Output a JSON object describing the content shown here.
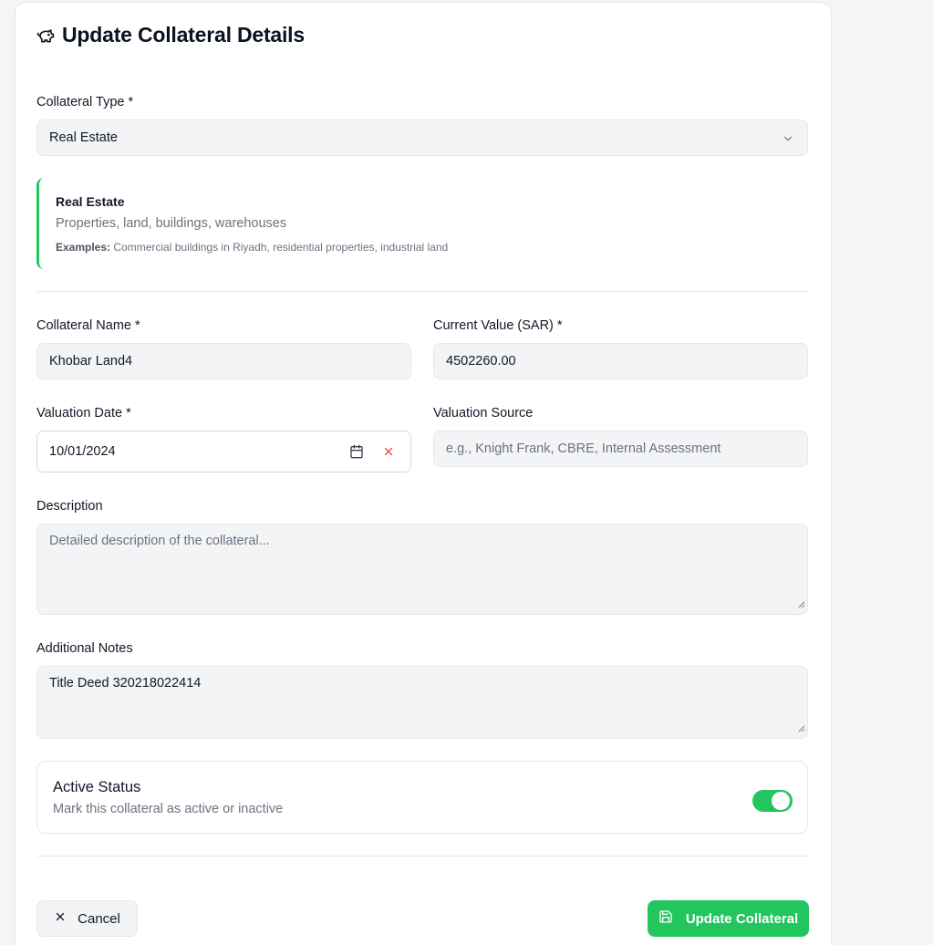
{
  "header": {
    "title": "Update Collateral Details",
    "icon": "piggy-bank-icon"
  },
  "collateral_type": {
    "label": "Collateral Type *",
    "value": "Real Estate"
  },
  "type_info": {
    "title": "Real Estate",
    "description": "Properties, land, buildings, warehouses",
    "examples_label": "Examples:",
    "examples_text": "Commercial buildings in Riyadh, residential properties, industrial land",
    "accent_color": "#22c55e"
  },
  "collateral_name": {
    "label": "Collateral Name *",
    "value": "Khobar Land4"
  },
  "current_value": {
    "label": "Current Value (SAR) *",
    "value": "4502260.00"
  },
  "valuation_date": {
    "label": "Valuation Date *",
    "value": "10/01/2024"
  },
  "valuation_source": {
    "label": "Valuation Source",
    "placeholder": "e.g., Knight Frank, CBRE, Internal Assessment"
  },
  "description": {
    "label": "Description",
    "placeholder": "Detailed description of the collateral..."
  },
  "notes": {
    "label": "Additional Notes",
    "value": "Title Deed 320218022414"
  },
  "status": {
    "title": "Active Status",
    "description": "Mark this collateral as active or inactive",
    "active": true
  },
  "actions": {
    "cancel_label": "Cancel",
    "update_label": "Update Collateral",
    "primary_color": "#22c55e"
  }
}
